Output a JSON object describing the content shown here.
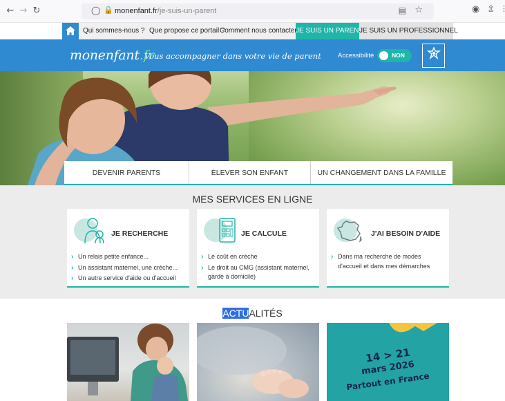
{
  "browser": {
    "url_domain": "monenfant.fr",
    "url_path": "/je-suis-un-parent",
    "back_icon": "arrow-left-icon",
    "forward_icon": "arrow-right-icon",
    "reload_icon": "reload-icon"
  },
  "topnav": {
    "items": [
      {
        "label": "Qui sommes-nous ?"
      },
      {
        "label": "Que propose ce portail ?"
      },
      {
        "label": "Comment nous contacter ?"
      },
      {
        "label": "JE SUIS UN PARENT"
      },
      {
        "label": "JE SUIS UN PROFESSIONNEL"
      }
    ],
    "accent": "#1fb5a9"
  },
  "header": {
    "logo_main": "monenfant",
    "logo_tld": ".fr",
    "tagline": "Vous accompagner dans votre vie de parent",
    "accessibility_label": "Accessibilité",
    "accessibility_value": "NON",
    "brand_color": "#2f8ad1"
  },
  "categories": [
    {
      "label": "DEVENIR PARENTS"
    },
    {
      "label": "ÉLEVER SON ENFANT"
    },
    {
      "label": "UN CHANGEMENT DANS LA FAMILLE"
    }
  ],
  "services": {
    "title": "MES SERVICES EN LIGNE",
    "cards": [
      {
        "title": "JE RECHERCHE",
        "icon": "parent-child-icon",
        "lines": [
          "Un relais petite enfance...",
          "Un assistant maternel, une crèche...",
          "Un autre service d'aide ou d'accueil"
        ]
      },
      {
        "title": "JE CALCULE",
        "icon": "calculator-icon",
        "lines": [
          "Le coût en crèche",
          "Le droit au CMG (assistant maternel, garde à domicile)"
        ]
      },
      {
        "title": "J'AI BESOIN D'AIDE",
        "icon": "france-map-icon",
        "lines": [
          "Dans ma recherche de modes d'accueil et dans mes démarches"
        ]
      }
    ]
  },
  "news": {
    "title_highlight": "ACTU",
    "title_rest": "ALITÉS",
    "event_line1": "14 > 21",
    "event_line2": "mars 2026",
    "event_line3": "Partout en France"
  }
}
